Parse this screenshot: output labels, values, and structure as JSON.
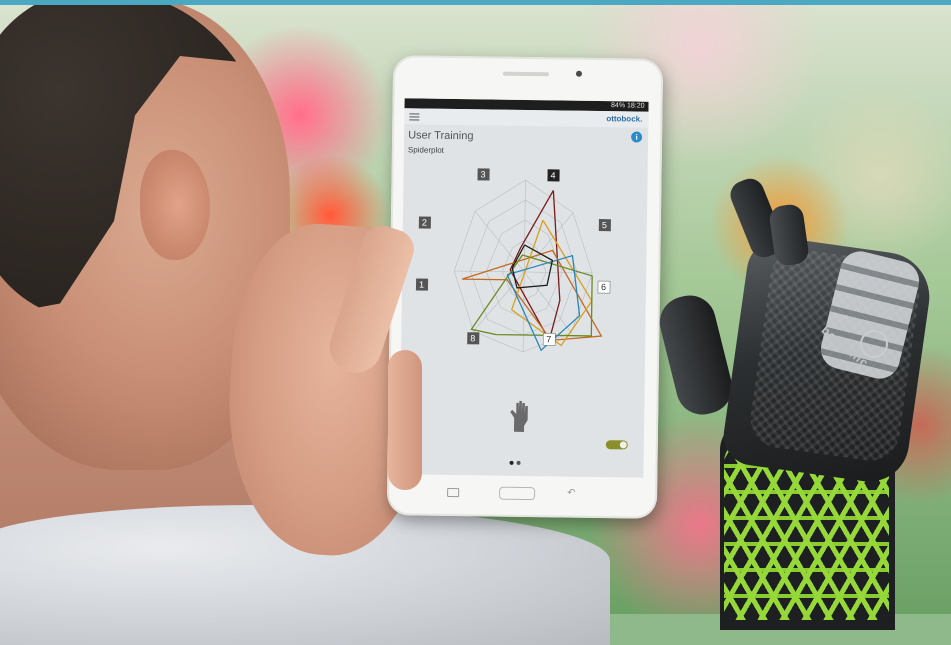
{
  "app": {
    "brand": "ottobock.",
    "title": "User Training",
    "subtitle": "Spiderplot",
    "status": "84% 18:20"
  },
  "spiderplot": {
    "axes": [
      "3",
      "4",
      "5",
      "6",
      "7",
      "8",
      "1",
      "2"
    ],
    "series_colors": [
      "#7a1a1a",
      "#c46a1f",
      "#d8a020",
      "#6a8a22",
      "#2a86b8",
      "#1e1e1e"
    ]
  },
  "hand_device": {
    "label": "bebionic"
  },
  "info_icon": "i",
  "colors": {
    "top_bar": "#4aa8c0",
    "toggle": "#8a8f2a",
    "lattice": "#9ee23b"
  }
}
